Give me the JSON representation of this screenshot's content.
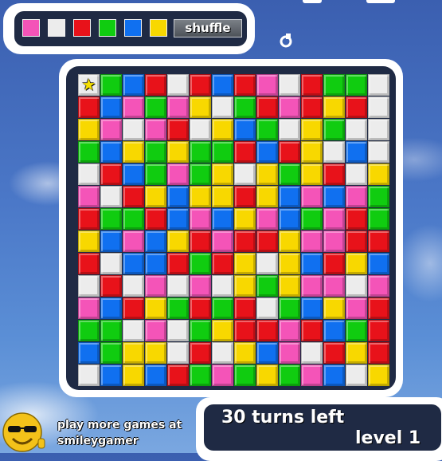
{
  "palette": {
    "colors": [
      {
        "name": "pink",
        "hex": "#f454b8"
      },
      {
        "name": "white",
        "hex": "#ececec"
      },
      {
        "name": "red",
        "hex": "#e8121a"
      },
      {
        "name": "green",
        "hex": "#10cc10"
      },
      {
        "name": "blue",
        "hex": "#1070f0"
      },
      {
        "name": "yellow",
        "hex": "#f8d800"
      }
    ],
    "shuffle_label": "shuffle"
  },
  "icons": {
    "restart": "restart-icon",
    "star": "star-icon",
    "smiley": "smiley-face-icon"
  },
  "board": {
    "start_icon": "★",
    "legend": {
      "P": "#f454b8",
      "W": "#ececec",
      "R": "#e8121a",
      "G": "#10cc10",
      "B": "#1070f0",
      "Y": "#f8d800"
    },
    "rows": [
      "WGBRWRBRPWRGG",
      "RBPGPYWGRPRYR",
      "YPWPRWYBGWYGW",
      "GBYGYGGRBRYWB",
      "WRBGPGYWYGYRWY",
      "PWRYBYYRYBPBPG",
      "RGGRBPBYPBGPRG",
      "YBPBYRPRRYPPRR",
      "RWBBRGRYWYBRYB",
      "WRWPWPWYGYPPWP",
      "PBRYGRGRWGBYPR",
      "GGWPWGYRRPRBGR",
      "BGYYWRWYBPWRYR",
      "WBYBRGPGYGPBWY"
    ]
  },
  "promo": {
    "line1": "play more games at",
    "line2": "smileygamer"
  },
  "status": {
    "turns_text": "30 turns left",
    "level_text": "level 1"
  }
}
